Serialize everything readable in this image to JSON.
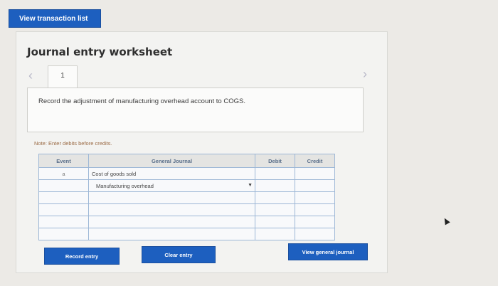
{
  "top": {
    "view_transaction_label": "View transaction list"
  },
  "worksheet": {
    "title": "Journal entry worksheet",
    "tab_number": "1",
    "instruction": "Record the adjustment of manufacturing overhead account to COGS.",
    "note": "Note: Enter debits before credits."
  },
  "table": {
    "headers": {
      "event": "Event",
      "general_journal": "General Journal",
      "debit": "Debit",
      "credit": "Credit"
    },
    "rows": [
      {
        "event": "a",
        "account": "Cost of goods sold",
        "debit": "",
        "credit": ""
      },
      {
        "event": "",
        "account": "Manufacturing overhead",
        "debit": "",
        "credit": ""
      },
      {
        "event": "",
        "account": "",
        "debit": "",
        "credit": ""
      },
      {
        "event": "",
        "account": "",
        "debit": "",
        "credit": ""
      },
      {
        "event": "",
        "account": "",
        "debit": "",
        "credit": ""
      },
      {
        "event": "",
        "account": "",
        "debit": "",
        "credit": ""
      }
    ]
  },
  "buttons": {
    "record_entry": "Record entry",
    "clear_entry": "Clear entry",
    "view_general_journal": "View general journal"
  },
  "icons": {
    "prev": "chevron-left-icon",
    "next": "chevron-right-icon",
    "dropdown": "caret-down-icon",
    "cursor": "mouse-pointer-icon"
  },
  "colors": {
    "accent": "#1d5fbf",
    "note": "#9a6a44",
    "grid": "#9db7d6"
  }
}
